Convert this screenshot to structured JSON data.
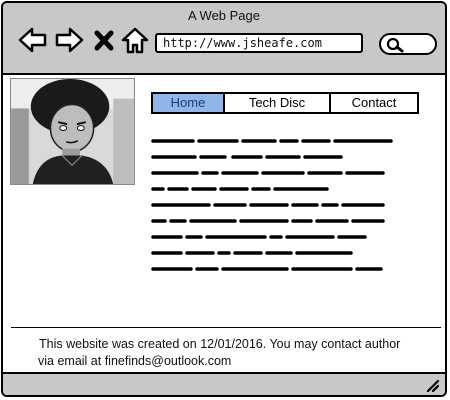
{
  "window": {
    "title": "A Web Page"
  },
  "toolbar": {
    "back_icon": "back-arrow-icon",
    "forward_icon": "forward-arrow-icon",
    "stop_icon": "close-icon",
    "home_icon": "home-icon",
    "url": "http://www.jsheafe.com",
    "search_icon": "search-icon"
  },
  "nav": {
    "tabs": [
      {
        "label": "Home",
        "active": true
      },
      {
        "label": "Tech Disc",
        "active": false
      },
      {
        "label": "Contact",
        "active": false
      }
    ]
  },
  "footer": {
    "line1": "This website was created on 12/01/2016. You may contact author",
    "line2": "via email at finefinds@outlook.com"
  },
  "colors": {
    "chrome": "#c8c8c8",
    "active_tab": "#8eb7e8"
  }
}
